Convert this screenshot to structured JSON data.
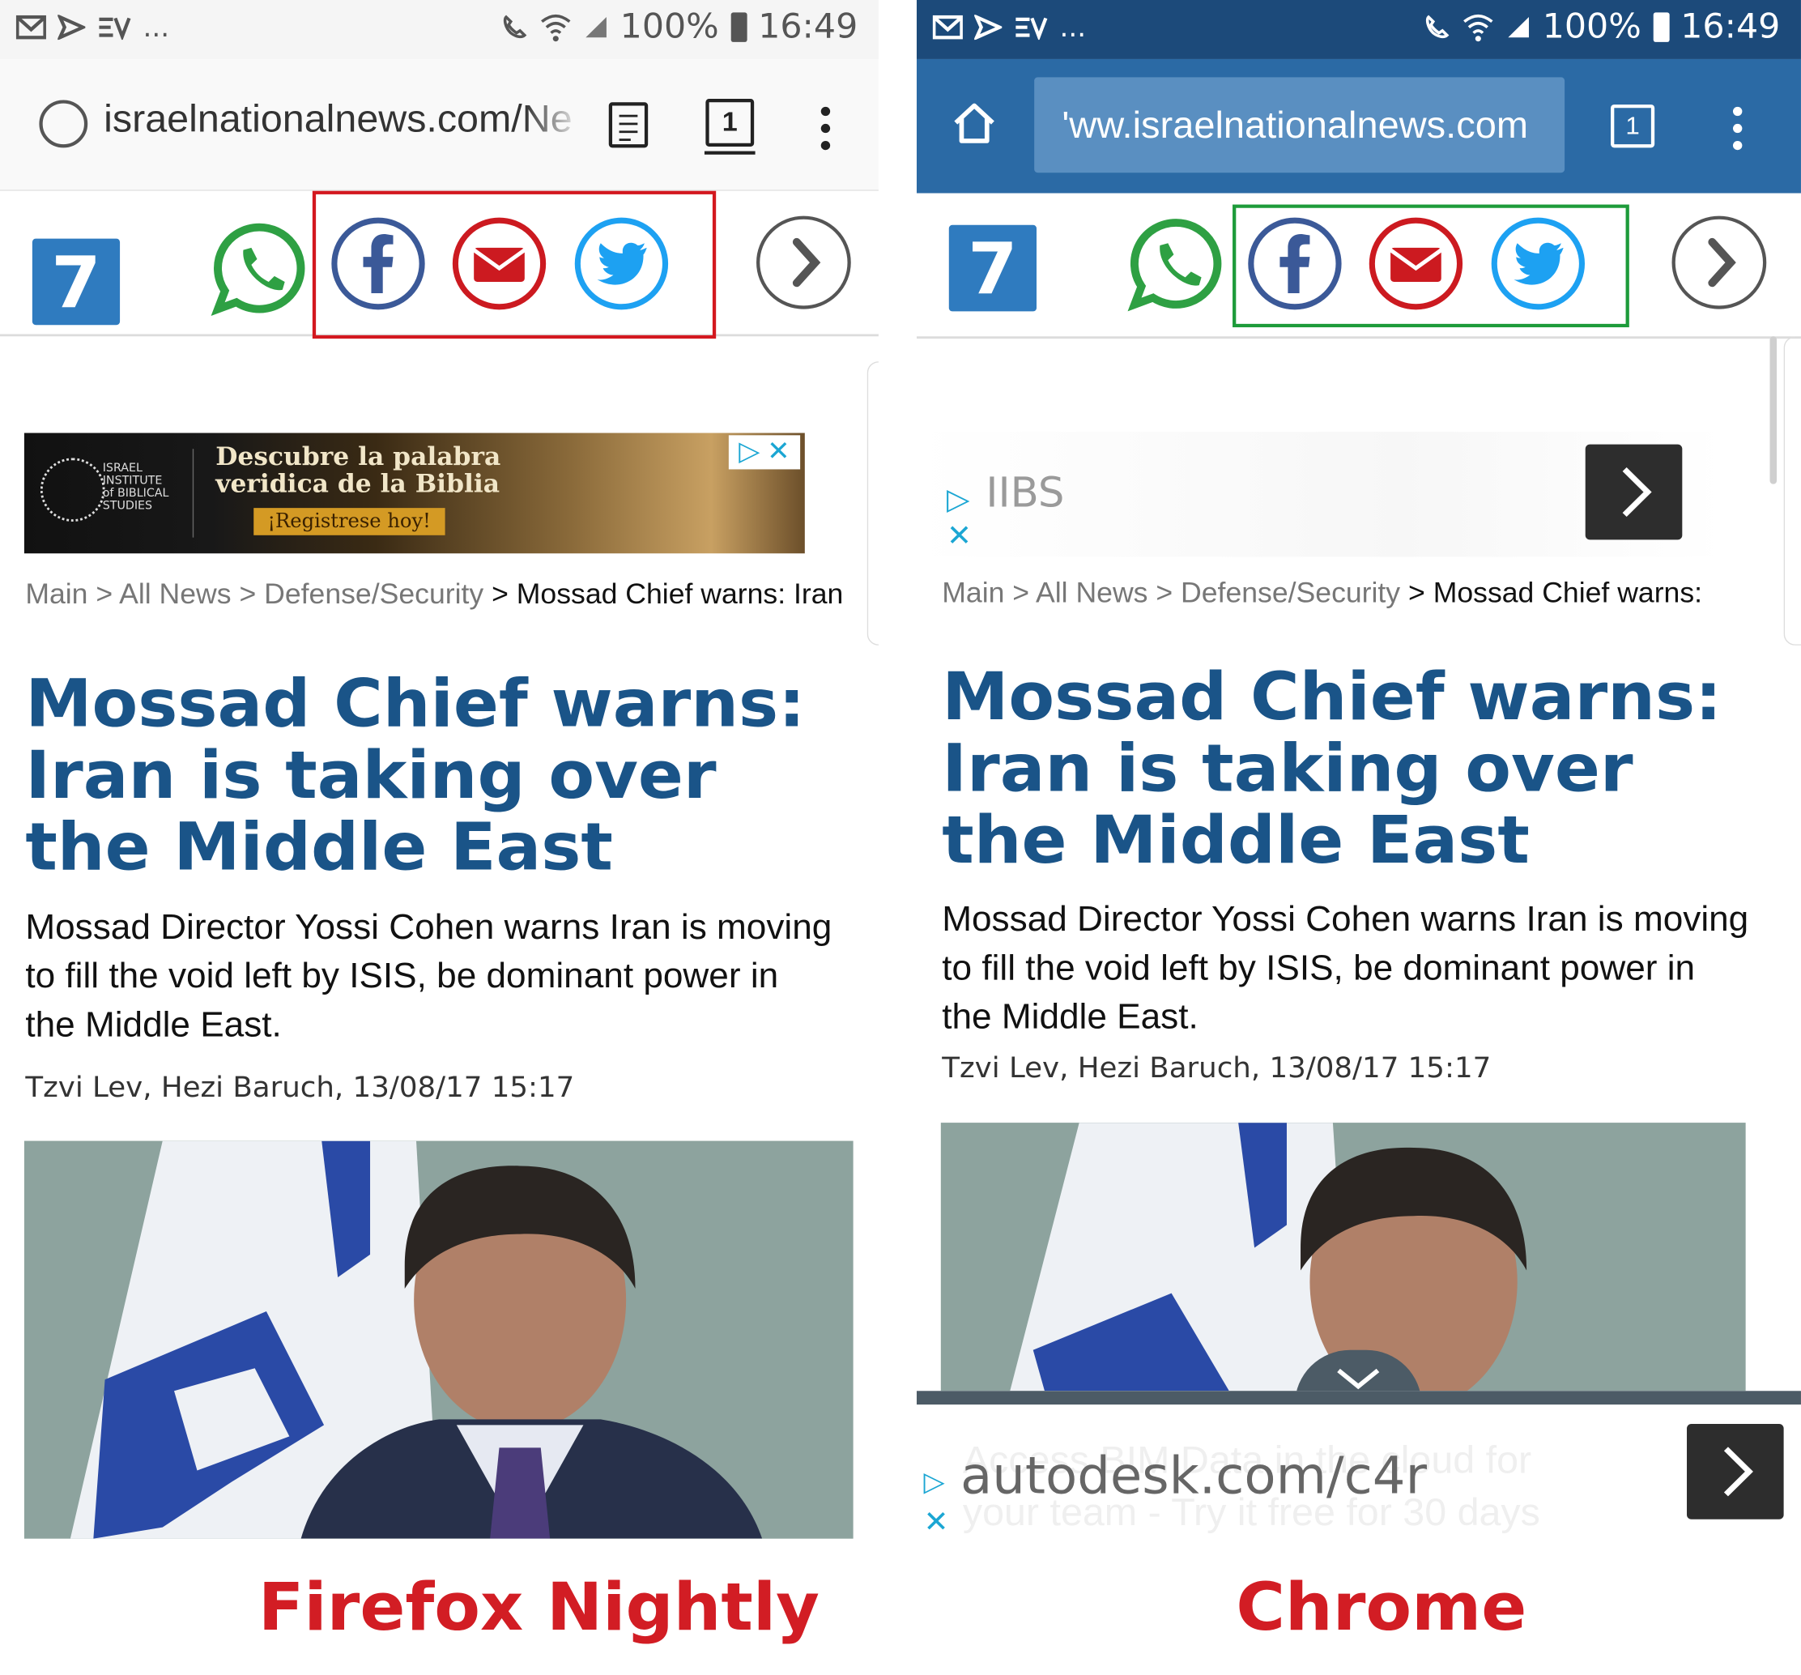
{
  "colors": {
    "headline": "#1a5488",
    "caption": "#d21d24",
    "firefox_highlight": "#d3181f",
    "chrome_highlight": "#1d9b3a",
    "chrome_toolbar": "#2b6aa5",
    "whatsapp": "#2ea043",
    "facebook": "#3b5998",
    "email": "#cc1a20",
    "twitter": "#1da1f2"
  },
  "left": {
    "status": {
      "notif_more": "...",
      "battery": "100%",
      "time": "16:49"
    },
    "toolbar": {
      "url": "israelnationalnews.com/Ne",
      "tab_count": "1"
    },
    "share": {
      "logo": "7",
      "icons": [
        "whatsapp-icon",
        "facebook-icon",
        "email-icon",
        "twitter-icon",
        "chevron-right-icon"
      ]
    },
    "ad": {
      "org_lines": [
        "ISRAEL",
        "INSTITUTE",
        "of BIBLICAL",
        "STUDIES"
      ],
      "line1": "Descubre la palabra",
      "line2": "veridica de la Biblia",
      "cta": "¡Registrese hoy!"
    },
    "breadcrumb": {
      "c1": "Main",
      "c2": "All News",
      "c3": "Defense/Security",
      "current": "Mossad Chief warns: Iran"
    },
    "headline": "Mossad Chief warns: Iran is taking over the Middle East",
    "summary": "Mossad Director Yossi Cohen warns Iran is moving to fill the void left by ISIS, be dominant power in the Middle East.",
    "byline": "Tzvi Lev, Hezi Baruch, 13/08/17 15:17",
    "caption": "Firefox Nightly"
  },
  "right": {
    "status": {
      "notif_more": "...",
      "battery": "100%",
      "time": "16:49"
    },
    "toolbar": {
      "url": "'ww.israelnationalnews.com",
      "tab_count": "1"
    },
    "share": {
      "logo": "7"
    },
    "ad": {
      "name": "IIBS"
    },
    "breadcrumb": {
      "c1": "Main",
      "c2": "All News",
      "c3": "Defense/Security",
      "current": "Mossad Chief warns:"
    },
    "headline": "Mossad Chief warns: Iran is taking over the Middle East",
    "summary": "Mossad Director Yossi Cohen warns Iran is moving to fill the void left by ISIS, be dominant power in the Middle East.",
    "byline": "Tzvi Lev, Hezi Baruch, 13/08/17 15:17",
    "bottom_ad": {
      "ghost_line1": "Access BIM Data in the cloud for",
      "ghost_line2": "your team - Try it free for 30 days",
      "url": "autodesk.com/c4r"
    },
    "caption": "Chrome"
  }
}
